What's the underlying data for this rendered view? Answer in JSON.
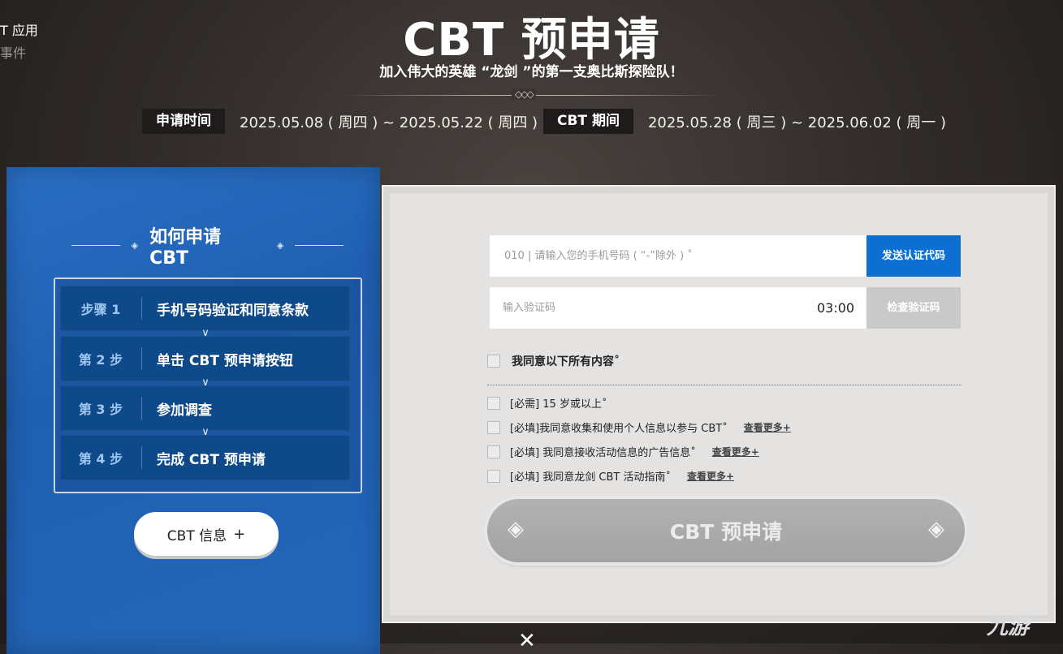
{
  "top_left": {
    "line1": "T 应用",
    "line2": "事件"
  },
  "hero": {
    "title": "CBT 预申请",
    "subtitle": "加入伟大的英雄 “龙剑 ”的第一支奥比斯探险队！",
    "divider_ornament": "◇◇◇"
  },
  "periods": [
    {
      "tag": "申请时间",
      "value": "2025.05.08 ( 周四 ) ~ 2025.05.22 ( 周四 )"
    },
    {
      "tag": "CBT 期间",
      "value": "2025.05.28 ( 周三 ) ~ 2025.06.02 ( 周一 )"
    }
  ],
  "howto": {
    "title": "如何申请 CBT",
    "steps": [
      {
        "no": "步骤 1",
        "label": "手机号码验证和同意条款"
      },
      {
        "no": "第 2 步",
        "label": "单击 CBT 预申请按钮"
      },
      {
        "no": "第 3 步",
        "label": "参加调查"
      },
      {
        "no": "第 4 步",
        "label": "完成 CBT 预申请"
      }
    ],
    "info_button": "CBT 信息",
    "info_button_icon": "plus-icon"
  },
  "form": {
    "phone_placeholder": "010 | 请输入您的手机号码 ( “-”除外 ) ˚",
    "send_button": "发送认证代码",
    "code_placeholder": "输入验证码",
    "timer": "03:00",
    "check_button": "检查验证码",
    "agree_all": "我同意以下所有内容˚",
    "terms": [
      {
        "text": "[必需] 15 岁或以上˚",
        "more": ""
      },
      {
        "text": "[必填]我同意收集和使用个人信息以参与 CBT˚",
        "more": "查看更多+"
      },
      {
        "text": "[必填] 我同意接收活动信息的广告信息˚",
        "more": "查看更多+"
      },
      {
        "text": "[必填] 我同意龙剑 CBT 活动指南˚",
        "more": "查看更多+"
      }
    ],
    "apply_button": "CBT 预申请"
  },
  "watermark": "九游",
  "colors": {
    "accent_blue": "#0d6fd1",
    "panel_blue": "#1f5fb1",
    "step_blue": "#0e4a8a"
  }
}
